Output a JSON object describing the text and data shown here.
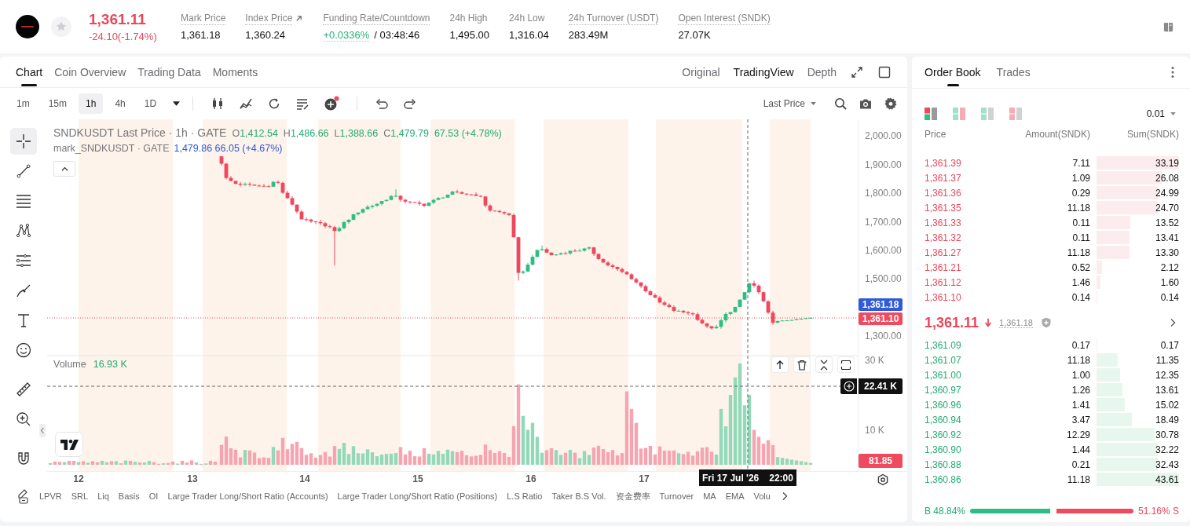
{
  "header": {
    "price": "1,361.11",
    "change": "-24.10(-1.74%)",
    "down": true,
    "starred": false,
    "stats": [
      {
        "label": "Mark Price",
        "value": "1,361.18",
        "kind": "plain",
        "tooltip": true
      },
      {
        "label": "Index Price",
        "value": "1,360.24",
        "kind": "link",
        "tooltip": true
      },
      {
        "label": "Funding Rate/Countdown",
        "value": "+0.0336%",
        "countdown": "/ 03:48:46",
        "kind": "funding",
        "tooltip": true
      },
      {
        "label": "24h High",
        "value": "1,495.00",
        "kind": "plain",
        "tooltip": false
      },
      {
        "label": "24h Low",
        "value": "1,316.04",
        "kind": "plain",
        "tooltip": false
      },
      {
        "label": "24h Turnover (USDT)",
        "value": "283.49M",
        "kind": "plain",
        "tooltip": true
      },
      {
        "label": "Open Interest (SNDK)",
        "value": "27.07K",
        "kind": "plain",
        "tooltip": true
      }
    ]
  },
  "chart_panel": {
    "tabs": [
      {
        "label": "Chart",
        "selected": true
      },
      {
        "label": "Coin Overview",
        "selected": false
      },
      {
        "label": "Trading Data",
        "selected": false
      },
      {
        "label": "Moments",
        "selected": false
      }
    ],
    "views": [
      {
        "label": "Original",
        "selected": false
      },
      {
        "label": "TradingView",
        "selected": true
      },
      {
        "label": "Depth",
        "selected": false
      }
    ],
    "intervals": [
      {
        "label": "1m",
        "selected": false
      },
      {
        "label": "15m",
        "selected": false
      },
      {
        "label": "1h",
        "selected": true
      },
      {
        "label": "4h",
        "selected": false
      },
      {
        "label": "1D",
        "selected": false
      }
    ],
    "price_source": "Last Price",
    "drawing_tools": [
      {
        "selected": true
      },
      {
        "selected": false
      },
      {
        "selected": false
      },
      {
        "selected": false
      },
      {
        "selected": false
      },
      {
        "selected": false
      },
      {
        "selected": false
      },
      {
        "selected": false
      },
      {
        "selected": false
      },
      {
        "selected": false
      },
      {
        "selected": false
      }
    ],
    "legend": {
      "title": "SNDKUSDT Last Price · 1h · GATE",
      "ohlc": [
        {
          "key": "O",
          "value": "1,412.54"
        },
        {
          "key": "H",
          "value": "1,486.66"
        },
        {
          "key": "L",
          "value": "1,388.66"
        },
        {
          "key": "C",
          "value": "1,479.79"
        }
      ],
      "change": "67.53 (+4.78%)",
      "mark_title": "mark_SNDKUSDT · GATE",
      "mark_values": "1,479.86 66.05 (+4.67%)"
    },
    "price_axis": [
      "2,000.00",
      "1,900.00",
      "1,800.00",
      "1,700.00",
      "1,600.00",
      "1,500.00",
      "1,300.00"
    ],
    "price_tags": [
      {
        "value": "1,361.18",
        "color": "#2f5bd9"
      },
      {
        "value": "1,361.10",
        "color": "#ef4a5e"
      }
    ],
    "volume": {
      "label": "Volume",
      "value": "16.93 K",
      "axis": [
        "30 K",
        "10 K"
      ],
      "cursor_value": "22.41 K",
      "last_value": "81.85"
    },
    "time_axis": [
      "12",
      "13",
      "14",
      "15",
      "16",
      "17"
    ],
    "crosshair_time": {
      "date": "Fri 17 Jul '26",
      "time": "22:00"
    },
    "indicators": [
      "LPVR",
      "SRL",
      "Liq",
      "Basis",
      "OI",
      "Large Trader Long/Short Ratio (Accounts)",
      "Large Trader Long/Short Ratio (Positions)",
      "L.S Ratio",
      "Taker B.S Vol.",
      "资金费率",
      "Turnover",
      "MA",
      "EMA",
      "Volu"
    ]
  },
  "order_book": {
    "tabs": [
      {
        "label": "Order Book",
        "selected": true
      },
      {
        "label": "Trades",
        "selected": false
      }
    ],
    "modes": [
      {
        "kind": "both",
        "selected": true
      },
      {
        "kind": "split",
        "selected": false
      },
      {
        "kind": "bids",
        "selected": false
      },
      {
        "kind": "asks",
        "selected": false
      }
    ],
    "precision": "0.01",
    "columns": [
      "Price",
      "Amount(SNDK)",
      "Sum(SNDK)"
    ],
    "asks": [
      {
        "price": "1,361.39",
        "amount": "7.11",
        "sum": "33.19",
        "level": 1.0
      },
      {
        "price": "1,361.37",
        "amount": "1.09",
        "sum": "26.08",
        "level": 0.786
      },
      {
        "price": "1,361.36",
        "amount": "0.29",
        "sum": "24.99",
        "level": 0.753
      },
      {
        "price": "1,361.35",
        "amount": "11.18",
        "sum": "24.70",
        "level": 0.744
      },
      {
        "price": "1,361.33",
        "amount": "0.11",
        "sum": "13.52",
        "level": 0.407
      },
      {
        "price": "1,361.32",
        "amount": "0.11",
        "sum": "13.41",
        "level": 0.404
      },
      {
        "price": "1,361.27",
        "amount": "11.18",
        "sum": "13.30",
        "level": 0.401
      },
      {
        "price": "1,361.21",
        "amount": "0.52",
        "sum": "2.12",
        "level": 0.064
      },
      {
        "price": "1,361.12",
        "amount": "1.46",
        "sum": "1.60",
        "level": 0.048
      },
      {
        "price": "1,361.10",
        "amount": "0.14",
        "sum": "0.14",
        "level": 0.004
      }
    ],
    "last": {
      "price": "1,361.11",
      "down": true,
      "mark": "1,361.18"
    },
    "bids": [
      {
        "price": "1,361.09",
        "amount": "0.17",
        "sum": "0.17",
        "level": 0.004
      },
      {
        "price": "1,361.07",
        "amount": "11.18",
        "sum": "11.35",
        "level": 0.26
      },
      {
        "price": "1,361.00",
        "amount": "1.00",
        "sum": "12.35",
        "level": 0.283
      },
      {
        "price": "1,360.97",
        "amount": "1.26",
        "sum": "13.61",
        "level": 0.312
      },
      {
        "price": "1,360.96",
        "amount": "1.41",
        "sum": "15.02",
        "level": 0.344
      },
      {
        "price": "1,360.94",
        "amount": "3.47",
        "sum": "18.49",
        "level": 0.424
      },
      {
        "price": "1,360.92",
        "amount": "12.29",
        "sum": "30.78",
        "level": 0.706
      },
      {
        "price": "1,360.90",
        "amount": "1.44",
        "sum": "32.22",
        "level": 0.739
      },
      {
        "price": "1,360.88",
        "amount": "0.21",
        "sum": "32.43",
        "level": 0.744
      },
      {
        "price": "1,360.86",
        "amount": "11.18",
        "sum": "43.61",
        "level": 1.0
      }
    ],
    "ratio": {
      "buy": "B 48.84%",
      "sell": "51.16% S",
      "level": 0.4884
    }
  }
}
